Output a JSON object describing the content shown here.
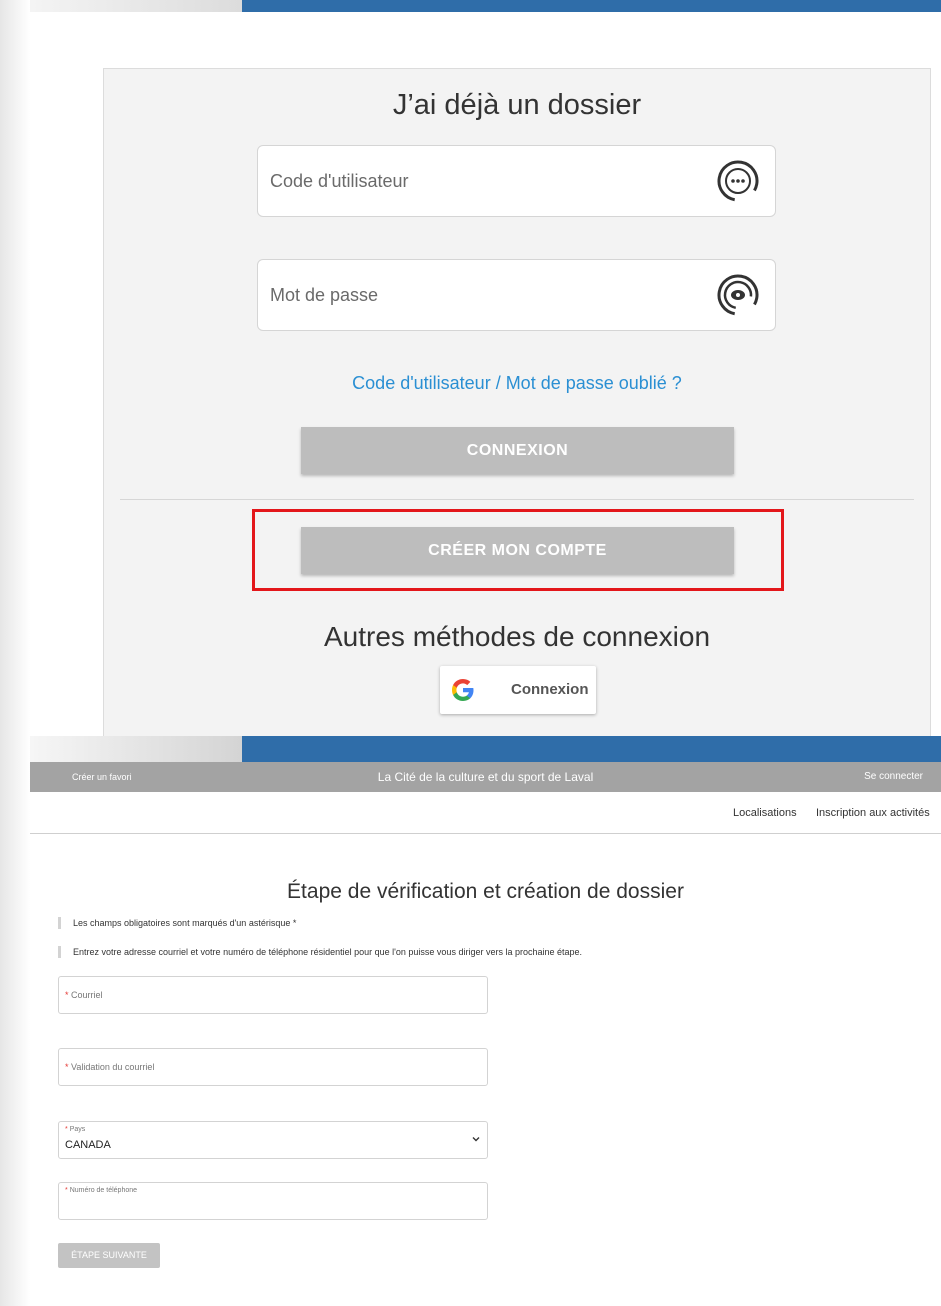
{
  "login": {
    "title": "J’ai déjà un dossier",
    "username_placeholder": "Code d'utilisateur",
    "password_placeholder": "Mot de passe",
    "forgot_link": "Code d'utilisateur / Mot de passe oublié ?",
    "connect_button": "CONNEXION",
    "create_account_button": "CRÉER MON COMPTE",
    "other_methods_title": "Autres méthodes de connexion",
    "google_button": "Connexion"
  },
  "site": {
    "favorite": "Créer un favori",
    "title": "La Cité de la culture et du sport de Laval",
    "login_link": "Se connecter",
    "nav": [
      "Localisations",
      "Inscription aux activités"
    ]
  },
  "registration": {
    "title": "Étape de vérification et création de dossier",
    "notes": [
      "Les champs obligatoires sont marqués d'un astérisque *",
      "Entrez votre adresse courriel et votre numéro de téléphone résidentiel pour que l'on puisse vous diriger vers la prochaine étape."
    ],
    "email_label": "Courriel",
    "email_confirm_label": "Validation du courriel",
    "country_label": "Pays",
    "country_value": "CANADA",
    "phone_label": "Numéro de téléphone",
    "required_marker": "*",
    "next_button": "ÉTAPE SUIVANTE"
  },
  "colors": {
    "top_bar": "#2f6da9",
    "panel_bg": "#f3f3f3",
    "button_gray": "#bdbdbd",
    "link_blue": "#2a8fd3",
    "highlight_red": "#e3161a",
    "site_bar": "#a3a3a3",
    "required_red": "#e53935"
  },
  "icons": [
    "password-dots-icon",
    "eye-icon",
    "google-g-icon",
    "chevron-down-icon"
  ]
}
